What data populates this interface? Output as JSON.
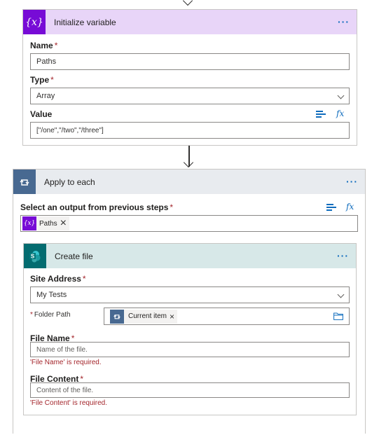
{
  "init_variable": {
    "title": "Initialize variable",
    "icon": "{x}",
    "name_label": "Name",
    "name_value": "Paths",
    "type_label": "Type",
    "type_value": "Array",
    "value_label": "Value",
    "value_value": "[\"/one\",\"/two\",\"/three\"]",
    "fx_label": "fx"
  },
  "apply_each": {
    "title": "Apply to each",
    "select_label": "Select an output from previous steps",
    "token_icon": "{x}",
    "token_label": "Paths",
    "fx_label": "fx"
  },
  "create_file": {
    "title": "Create file",
    "site_label": "Site Address",
    "site_value": "My Tests",
    "folder_label": "Folder Path",
    "folder_token": "Current item",
    "filename_label": "File Name",
    "filename_placeholder": "Name of the file.",
    "filename_error": "'File Name' is required.",
    "content_label": "File Content",
    "content_placeholder": "Content of the file.",
    "content_error": "'File Content' is required."
  },
  "common": {
    "required_mark": "*",
    "more_dots": "···",
    "remove_x": "×"
  },
  "colors": {
    "variable": "#770bd6",
    "variable_header": "#e8d5f8",
    "loop": "#486991",
    "loop_header": "#e8ebef",
    "sharepoint": "#036c70",
    "sharepoint_header": "#d7e8e8",
    "link": "#0f6cbd",
    "error": "#a4262c"
  },
  "icons": [
    "variable-icon",
    "loop-icon",
    "sharepoint-icon",
    "folder-icon",
    "dynamic-content-icon",
    "fx-icon",
    "chevron-down-icon",
    "more-icon",
    "close-icon",
    "arrow-down-icon"
  ]
}
